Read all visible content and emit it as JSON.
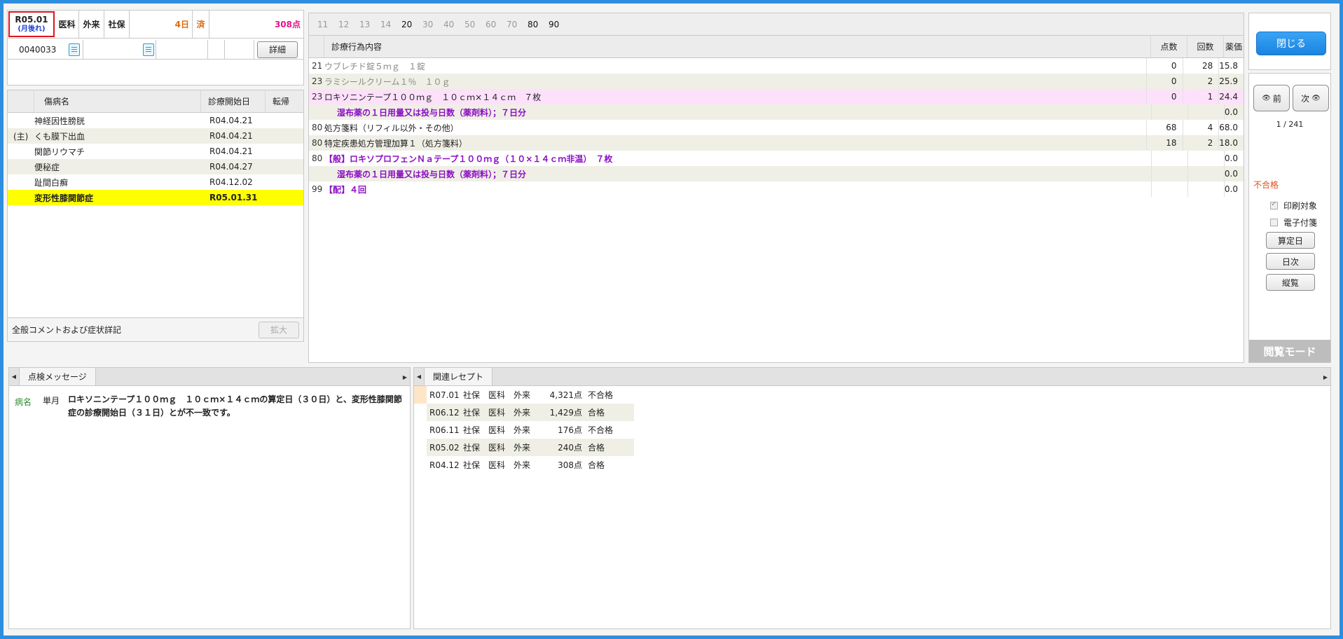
{
  "header": {
    "date": "R05.01",
    "date_note": "(月後れ)",
    "dept": "医科",
    "visit_type": "外来",
    "insurance": "社保",
    "days": "4日",
    "status": "済",
    "points": "308点",
    "patient_id": "0040033",
    "detail_button": "詳細"
  },
  "disease": {
    "col_name": "傷病名",
    "col_start": "診療開始日",
    "col_outcome": "転帰",
    "rows": [
      {
        "prefix": "",
        "name": "神経因性膀胱",
        "start": "R04.04.21"
      },
      {
        "prefix": "(主)",
        "name": "くも膜下出血",
        "start": "R04.04.21"
      },
      {
        "prefix": "",
        "name": "関節リウマチ",
        "start": "R04.04.21"
      },
      {
        "prefix": "",
        "name": "便秘症",
        "start": "R04.04.27"
      },
      {
        "prefix": "",
        "name": "趾間白癬",
        "start": "R04.12.02"
      },
      {
        "prefix": "",
        "name": "変形性膝関節症",
        "start": "R05.01.31"
      }
    ],
    "comment_label": "全般コメントおよび症状詳記",
    "expand_button": "拡大"
  },
  "days_bar": [
    "11",
    "12",
    "13",
    "14",
    "20",
    "30",
    "40",
    "50",
    "60",
    "70",
    "80",
    "90"
  ],
  "days_active": [
    "20",
    "80",
    "90"
  ],
  "treatment": {
    "col_content": "診療行為内容",
    "col_points": "点数",
    "col_count": "回数",
    "col_drug": "薬価",
    "rows": [
      {
        "code": "21",
        "text": "ウブレチド錠５ｍｇ　１錠",
        "points": "0",
        "count": "28",
        "drug": "15.8"
      },
      {
        "code": "23",
        "text": "ラミシールクリーム１％　１０ｇ",
        "points": "0",
        "count": "2",
        "drug": "25.9"
      },
      {
        "code": "23",
        "text": "ロキソニンテープ１００ｍｇ　１０ｃｍ×１４ｃｍ　７枚",
        "points": "0",
        "count": "1",
        "drug": "24.4"
      },
      {
        "code": "",
        "text": "湿布薬の１日用量又は投与日数（薬剤料）；７日分",
        "points": "",
        "count": "",
        "drug": "0.0"
      },
      {
        "code": "80",
        "text": "処方箋料（リフィル以外・その他）",
        "points": "68",
        "count": "4",
        "drug": "68.0"
      },
      {
        "code": "80",
        "text": "特定疾患処方管理加算１（処方箋料）",
        "points": "18",
        "count": "2",
        "drug": "18.0"
      },
      {
        "code": "80",
        "text": "【般】ロキソプロフェンＮａテープ１００ｍｇ（１０×１４ｃｍ非温）　７枚",
        "points": "",
        "count": "",
        "drug": "0.0"
      },
      {
        "code": "",
        "text": "湿布薬の１日用量又は投与日数（薬剤料）；７日分",
        "points": "",
        "count": "",
        "drug": "0.0"
      },
      {
        "code": "99",
        "text": "【配】４回",
        "points": "",
        "count": "",
        "drug": "0.0"
      }
    ]
  },
  "side": {
    "close_button": "閉じる",
    "prev_button": "前",
    "next_button": "次",
    "page": "1 / 241",
    "result": "不合格",
    "print_target": "印刷対象",
    "e_tag": "電子付箋",
    "calc_day_button": "算定日",
    "daily_button": "日次",
    "overview_button": "縦覧",
    "mode_label": "閲覧モード"
  },
  "messages": {
    "tab": "点検メッセージ",
    "items": [
      {
        "category": "病名",
        "scope": "単月",
        "text": "ロキソニンテープ１００ｍｇ　１０ｃｍ×１４ｃｍの算定日（３０日）と、変形性膝関節症の診療開始日（３１日）とが不一致です。"
      }
    ]
  },
  "related": {
    "tab": "関連レセプト",
    "rows": [
      {
        "date": "R07.01",
        "ins": "社保",
        "dept": "医科",
        "visit": "外来",
        "points": "4,321点",
        "result": "不合格"
      },
      {
        "date": "R06.12",
        "ins": "社保",
        "dept": "医科",
        "visit": "外来",
        "points": "1,429点",
        "result": "合格"
      },
      {
        "date": "R06.11",
        "ins": "社保",
        "dept": "医科",
        "visit": "外来",
        "points": "176点",
        "result": "不合格"
      },
      {
        "date": "R05.02",
        "ins": "社保",
        "dept": "医科",
        "visit": "外来",
        "points": "240点",
        "result": "合格"
      },
      {
        "date": "R04.12",
        "ins": "社保",
        "dept": "医科",
        "visit": "外来",
        "points": "308点",
        "result": "合格"
      }
    ]
  },
  "colors": {
    "frame": "#2e8fdf",
    "selected_row": "#ffff00",
    "highlight_row": "#fde1fb",
    "purple_text": "#8b0fc4",
    "fail_text": "#e0501e"
  }
}
